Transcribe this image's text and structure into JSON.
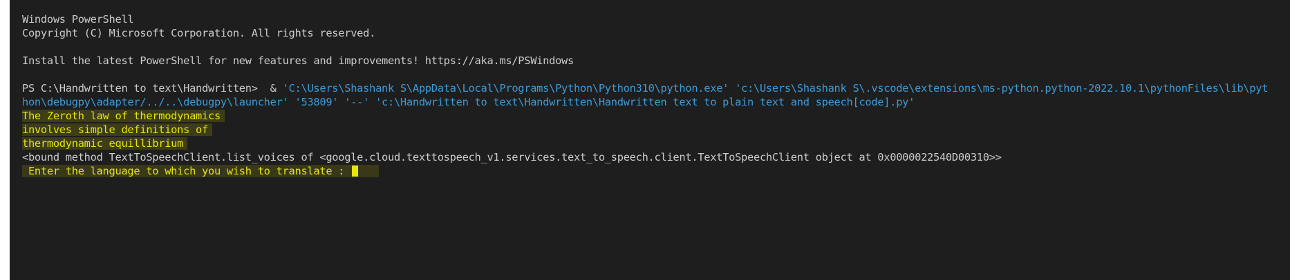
{
  "terminal": {
    "lines": {
      "title": "Windows PowerShell",
      "copyright": "Copyright (C) Microsoft Corporation. All rights reserved.",
      "install_msg": "Install the latest PowerShell for new features and improvements! https://aka.ms/PSWindows",
      "prompt": "PS C:\\Handwritten to text\\Handwritten>  & ",
      "cmd_part1": "'C:\\Users\\Shashank S\\AppData\\Local\\Programs\\Python\\Python310\\python.exe' 'c:\\Users\\Shashank S\\.vscode\\extensions\\ms-python.python-2022.10.1\\pythonFiles\\lib\\pyt",
      "cmd_part2": "hon\\debugpy\\adapter/../..\\debugpy\\launcher' '53809' '--' 'c:\\Handwritten to text\\Handwritten\\Handwritten text to plain text and speech[code].py'",
      "output1": "The Zeroth law of thermodynamics",
      "output2": "involves simple definitions of",
      "output3": "thermodynamic equillibrium",
      "bound_method": "<bound method TextToSpeechClient.list_voices of <google.cloud.texttospeech_v1.services.text_to_speech.client.TextToSpeechClient object at 0x0000022540D00310>>",
      "input_prompt": " Enter the language to which you wish to translate : "
    },
    "colors": {
      "background": "#1e1e1e",
      "text": "#cccccc",
      "string": "#3b9cd9",
      "output_yellow": "#e5e510"
    }
  }
}
